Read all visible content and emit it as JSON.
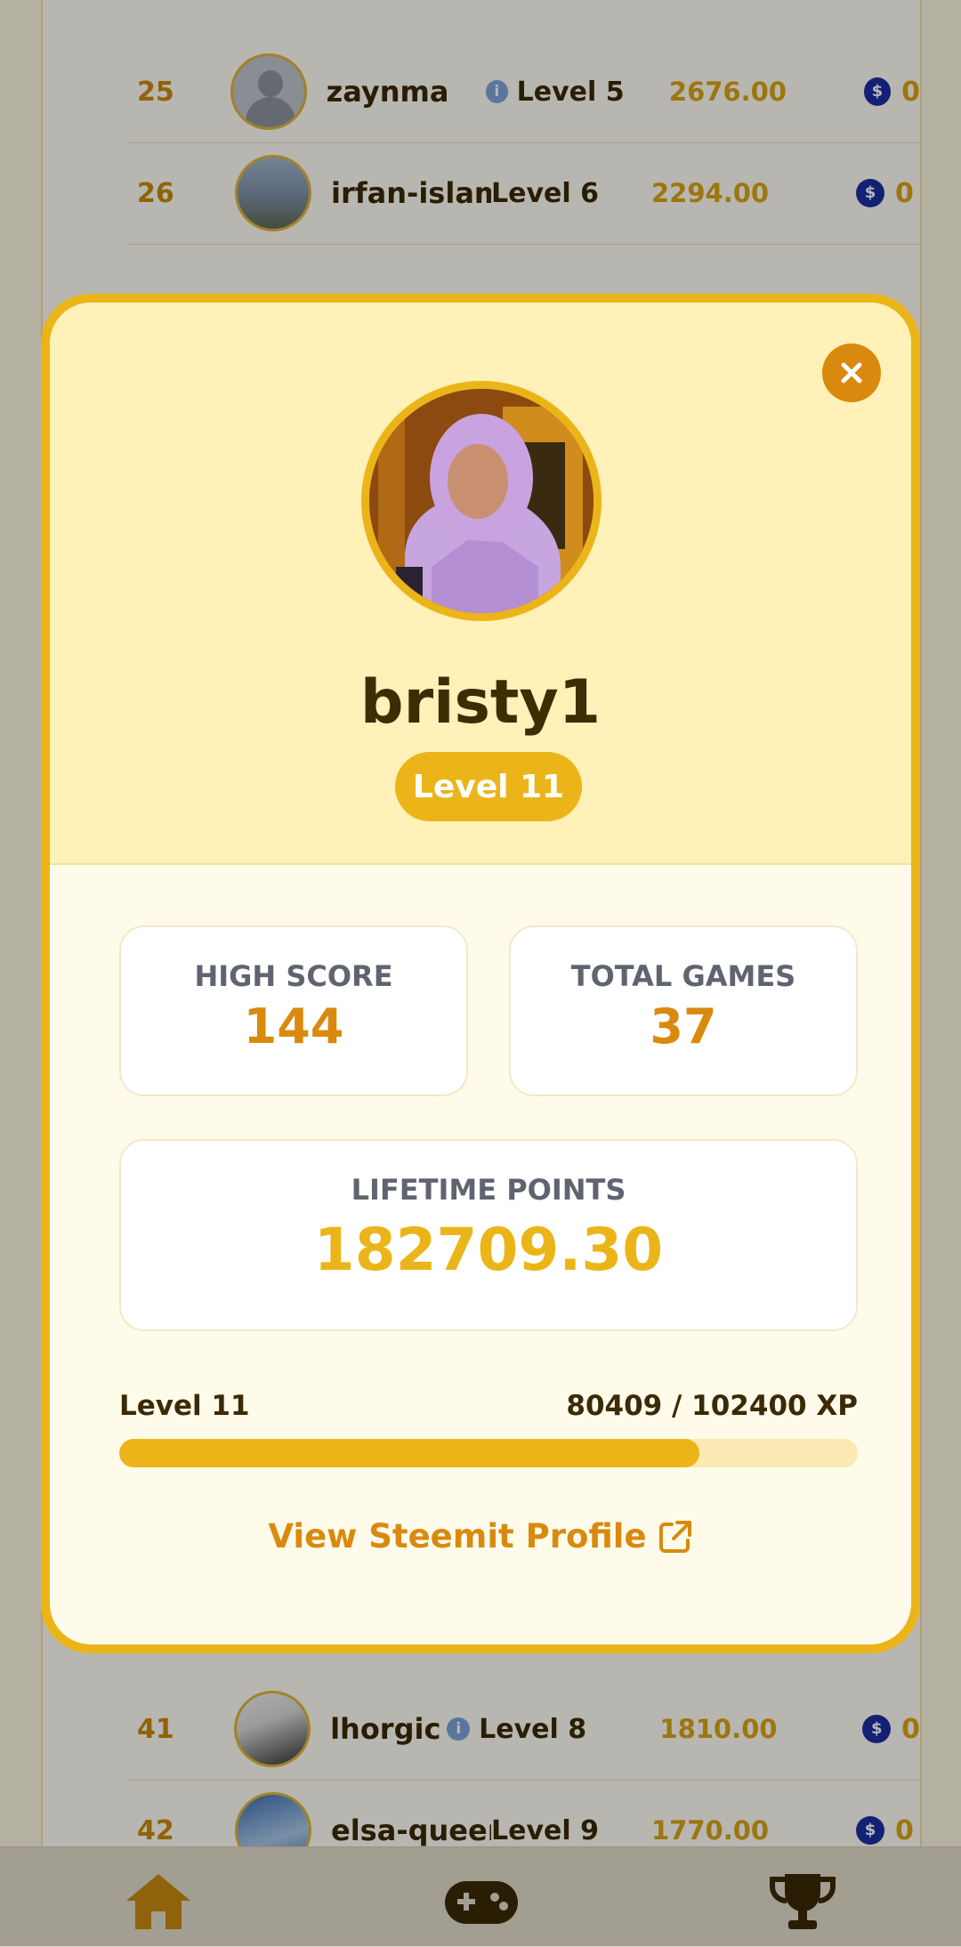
{
  "leaderboard": {
    "rows": [
      {
        "rank": "25",
        "name": "zaynma",
        "level": "Level 5",
        "points": "2676.00",
        "count": "0",
        "avatar": "default"
      },
      {
        "rank": "26",
        "name": "irfan-islam",
        "level": "Level 6",
        "points": "2294.00",
        "count": "0",
        "avatar": "photo"
      },
      {
        "rank": "41",
        "name": "lhorgic",
        "level": "Level 8",
        "points": "1810.00",
        "count": "0",
        "avatar": "dark"
      },
      {
        "rank": "42",
        "name": "elsa-queen",
        "level": "Level 9",
        "points": "1770.00",
        "count": "0",
        "avatar": "blue"
      }
    ]
  },
  "modal": {
    "username": "bristy1",
    "level_badge": "Level 11",
    "high_score_label": "HIGH SCORE",
    "high_score_value": "144",
    "total_games_label": "TOTAL GAMES",
    "total_games_value": "37",
    "lifetime_points_label": "LIFETIME POINTS",
    "lifetime_points_value": "182709.30",
    "xp_level_label": "Level 11",
    "xp_progress_text": "80409 / 102400 XP",
    "xp_current": 80409,
    "xp_total": 102400,
    "steemit_link_label": "View Steemit Profile",
    "close_icon": "close-icon",
    "external_link_icon": "external-link-icon"
  },
  "nav": {
    "items": [
      {
        "icon": "home-icon"
      },
      {
        "icon": "gamepad-icon"
      },
      {
        "icon": "trophy-icon"
      }
    ]
  },
  "colors": {
    "accent": "#ebb519",
    "accent_dark": "#d98a0e",
    "text_dark": "#3e2c03",
    "steem_blue": "#1b2fa3"
  }
}
